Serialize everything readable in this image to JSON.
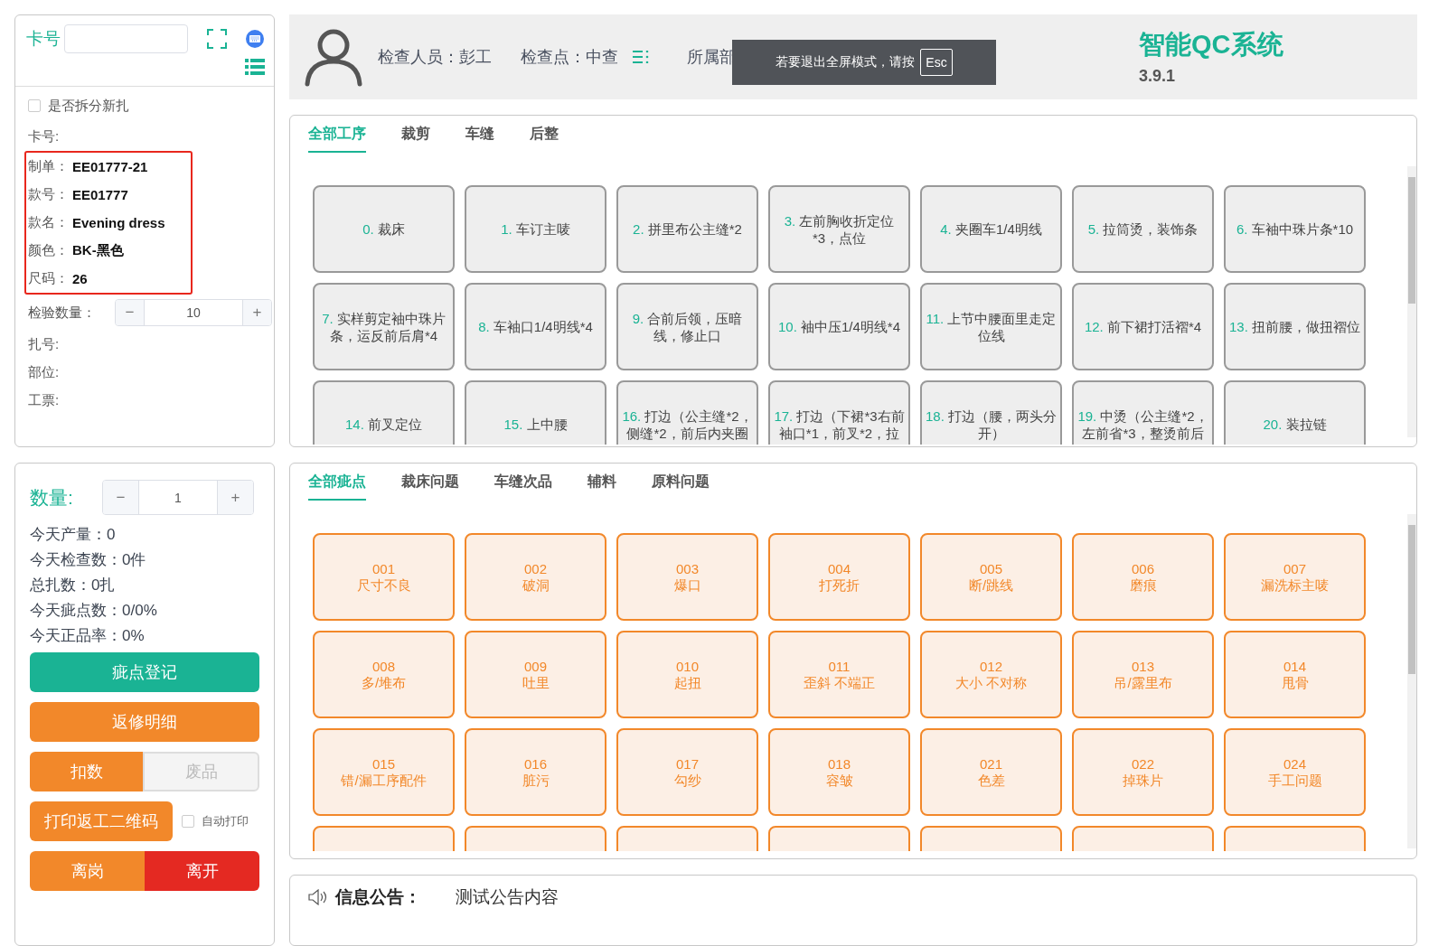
{
  "card_panel": {
    "card_label": "卡号",
    "split_checkbox": {
      "label": "是否拆分新扎",
      "checked": false
    },
    "card_no_label": "卡号:",
    "order_info": [
      {
        "label": "制单：",
        "value": "EE01777-21"
      },
      {
        "label": "款号：",
        "value": "EE01777"
      },
      {
        "label": "款名：",
        "value": "Evening dress"
      },
      {
        "label": "颜色：",
        "value": "BK-黑色"
      },
      {
        "label": "尺码：",
        "value": "26"
      }
    ],
    "inspect_qty": {
      "label": "检验数量：",
      "minus": "−",
      "value": "10",
      "plus": "+"
    },
    "extra_fields": [
      "扎号:",
      "部位:",
      "工票:"
    ]
  },
  "stats_panel": {
    "qty_label": "数量:",
    "qty": {
      "minus": "−",
      "value": "1",
      "plus": "+"
    },
    "stats": [
      "今天产量：0",
      "今天检查数：0件",
      "总扎数：0扎",
      "今天疵点数：0/0%",
      "今天正品率：0%"
    ],
    "rows": [
      [
        {
          "kind": "button",
          "label": "疵点登记",
          "color": "#1ab394",
          "disabled": false
        }
      ],
      [
        {
          "kind": "button",
          "label": "返修明细",
          "color": "#f2882a",
          "disabled": false
        }
      ],
      [
        {
          "kind": "button",
          "label": "扣数",
          "color": "#f2882a",
          "disabled": false
        },
        {
          "kind": "button",
          "label": "废品",
          "color": "#f4f4f4",
          "disabled": true
        }
      ],
      [
        {
          "kind": "button",
          "label": "打印返工二维码",
          "color": "#f2882a",
          "disabled": false
        },
        {
          "kind": "checkbox",
          "label": "自动打印",
          "checked": false
        }
      ],
      [
        {
          "kind": "button",
          "label": "离岗",
          "color": "#f2882a",
          "disabled": false
        },
        {
          "kind": "button",
          "label": "离开",
          "color": "#e42922",
          "disabled": false
        }
      ]
    ]
  },
  "header": {
    "inspector": "检查人员：彭工",
    "checkpoint": "检查点：中查",
    "department": "所属部",
    "app_title": "智能QC系统",
    "version": "3.9.1",
    "toast": {
      "text": "若要退出全屏模式，请按",
      "key": "Esc"
    }
  },
  "process_panel": {
    "tabs": [
      {
        "label": "全部工序",
        "selected": true
      },
      {
        "label": "裁剪",
        "selected": false
      },
      {
        "label": "车缝",
        "selected": false
      },
      {
        "label": "后整",
        "selected": false
      }
    ],
    "processes": [
      {
        "num": "0.",
        "name": "裁床"
      },
      {
        "num": "1.",
        "name": "车订主唛"
      },
      {
        "num": "2.",
        "name": "拼里布公主缝*2"
      },
      {
        "num": "3.",
        "name": "左前胸收折定位*3，点位"
      },
      {
        "num": "4.",
        "name": "夹圈车1/4明线"
      },
      {
        "num": "5.",
        "name": "拉筒烫，装饰条"
      },
      {
        "num": "6.",
        "name": "车袖中珠片条*10"
      },
      {
        "num": "7.",
        "name": "实样剪定袖中珠片条，运反前后肩*4"
      },
      {
        "num": "8.",
        "name": "车袖口1/4明线*4"
      },
      {
        "num": "9.",
        "name": "合前后领，压暗线，修止口"
      },
      {
        "num": "10.",
        "name": "袖中压1/4明线*4"
      },
      {
        "num": "11.",
        "name": "上节中腰面里走定位线"
      },
      {
        "num": "12.",
        "name": "前下裙打活褶*4"
      },
      {
        "num": "13.",
        "name": "扭前腰，做扭褶位"
      },
      {
        "num": "14.",
        "name": "前叉定位"
      },
      {
        "num": "15.",
        "name": "上中腰"
      },
      {
        "num": "16.",
        "name": "打边（公主缝*2，侧缝*2，前后内夹圈"
      },
      {
        "num": "17.",
        "name": "打边（下裙*3右前袖口*1，前叉*2，拉"
      },
      {
        "num": "18.",
        "name": "打边（腰，两头分开）"
      },
      {
        "num": "19.",
        "name": "中烫（公主缝*2，左前省*3，整烫前后"
      },
      {
        "num": "20.",
        "name": "装拉链"
      }
    ]
  },
  "defect_panel": {
    "tabs": [
      {
        "label": "全部疵点",
        "selected": true
      },
      {
        "label": "裁床问题",
        "selected": false
      },
      {
        "label": "车缝次品",
        "selected": false
      },
      {
        "label": "辅料",
        "selected": false
      },
      {
        "label": "原料问题",
        "selected": false
      }
    ],
    "defects": [
      {
        "kind": "defect",
        "code": "001",
        "name": "尺寸不良"
      },
      {
        "kind": "defect",
        "code": "002",
        "name": "破洞"
      },
      {
        "kind": "defect",
        "code": "003",
        "name": "爆口"
      },
      {
        "kind": "defect",
        "code": "004",
        "name": "打死折"
      },
      {
        "kind": "defect",
        "code": "005",
        "name": "断/跳线"
      },
      {
        "kind": "defect",
        "code": "006",
        "name": "磨痕"
      },
      {
        "kind": "defect",
        "code": "007",
        "name": "漏洗标主唛"
      },
      {
        "kind": "defect",
        "code": "008",
        "name": "多/堆布"
      },
      {
        "kind": "defect",
        "code": "009",
        "name": "吐里"
      },
      {
        "kind": "defect",
        "code": "010",
        "name": "起扭"
      },
      {
        "kind": "defect",
        "code": "011",
        "name": "歪斜 不端正"
      },
      {
        "kind": "defect",
        "code": "012",
        "name": "大小 不对称"
      },
      {
        "kind": "defect",
        "code": "013",
        "name": "吊/露里布"
      },
      {
        "kind": "defect",
        "code": "014",
        "name": "甩骨"
      },
      {
        "kind": "defect",
        "code": "015",
        "name": "错/漏工序配件"
      },
      {
        "kind": "defect",
        "code": "016",
        "name": "脏污"
      },
      {
        "kind": "defect",
        "code": "017",
        "name": "勾纱"
      },
      {
        "kind": "defect",
        "code": "018",
        "name": "容皱"
      },
      {
        "kind": "defect",
        "code": "021",
        "name": "色差"
      },
      {
        "kind": "defect",
        "code": "022",
        "name": "掉珠片"
      },
      {
        "kind": "defect",
        "code": "024",
        "name": "手工问题"
      },
      {
        "kind": "clipped"
      },
      {
        "kind": "clipped"
      },
      {
        "kind": "clipped"
      },
      {
        "kind": "clipped"
      },
      {
        "kind": "clipped"
      },
      {
        "kind": "clipped"
      },
      {
        "kind": "clipped"
      }
    ]
  },
  "notice": {
    "label": "信息公告：",
    "text": "测试公告内容"
  }
}
